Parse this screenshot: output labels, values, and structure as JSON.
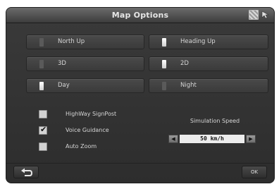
{
  "window": {
    "title": "Map Options",
    "icons": [
      "map-grid-icon",
      "cursor-arrow-icon"
    ]
  },
  "options": {
    "orientation": [
      {
        "label": "North Up",
        "selected": false
      },
      {
        "label": "Heading Up",
        "selected": true
      }
    ],
    "view": [
      {
        "label": "3D",
        "selected": false
      },
      {
        "label": "2D",
        "selected": true
      }
    ],
    "mode": [
      {
        "label": "Day",
        "selected": true
      },
      {
        "label": "Night",
        "selected": false
      }
    ]
  },
  "checks": [
    {
      "label": "HighWay SignPost",
      "checked": false
    },
    {
      "label": "Voice Guidance",
      "checked": true
    },
    {
      "label": "Auto Zoom",
      "checked": false
    }
  ],
  "simulation": {
    "title": "Simulation Speed",
    "value": "50 km/h",
    "dec_glyph": "◀",
    "inc_glyph": "▶"
  },
  "footer": {
    "ok_label": "OK"
  },
  "check_glyph": "✔"
}
